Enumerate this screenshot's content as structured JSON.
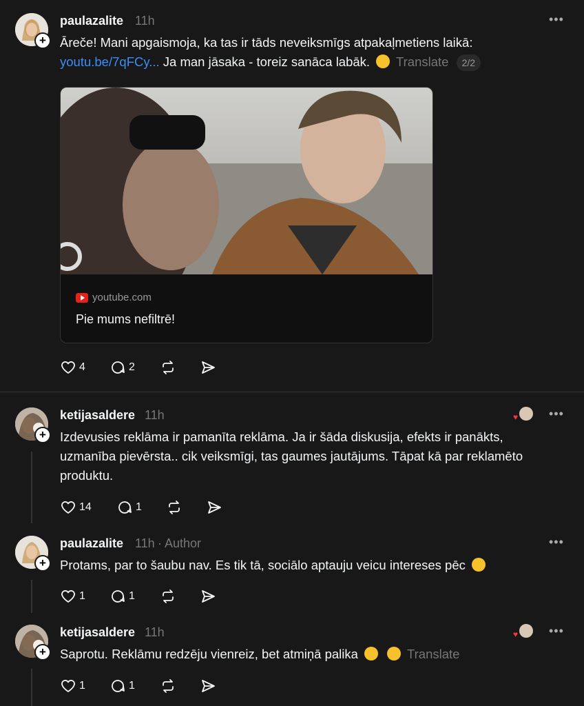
{
  "posts": [
    {
      "username": "paulazalite",
      "time": "11h",
      "text_a": "Āreče! Mani apgaismoja, ka tas ir tāds neveiksmīgs atpakaļmetiens laikā:",
      "link": "youtu.be/7qFCy...",
      "text_b": " Ja man jāsaka - toreiz sanāca labāk.",
      "translate": "Translate",
      "pager": "2/2",
      "card": {
        "domain": "youtube.com",
        "title": "Pie mums nefiltrē!"
      },
      "likes": "4",
      "replies": "2"
    },
    {
      "username": "ketijasaldere",
      "time": "11h",
      "text": "Izdevusies reklāma ir pamanīta reklāma. Ja ir šāda diskusija, efekts ir panākts, uzmanība pievērsta.. cik veiksmīgi, tas gaumes jautājums. Tāpat kā par reklamēto produktu.",
      "likes": "14",
      "replies": "1"
    },
    {
      "username": "paulazalite",
      "time": "11h",
      "author_label": "· Author",
      "text": "Protams, par to šaubu nav. Es tik tā, sociālo aptauju veicu intereses pēc",
      "likes": "1",
      "replies": "1"
    },
    {
      "username": "ketijasaldere",
      "time": "11h",
      "text": "Saprotu. Reklāmu redzēju vienreiz, bet atmiņā palika",
      "translate": "Translate",
      "likes": "1",
      "replies": "1"
    }
  ],
  "icons": {
    "more": "more-icon",
    "like": "heart-icon",
    "reply": "comment-icon",
    "repost": "repost-icon",
    "share": "share-icon",
    "follow": "plus-icon"
  },
  "colors": {
    "background": "#181818",
    "link": "#3a8ef6",
    "muted": "#777777",
    "liked_heart": "#ff3040"
  }
}
